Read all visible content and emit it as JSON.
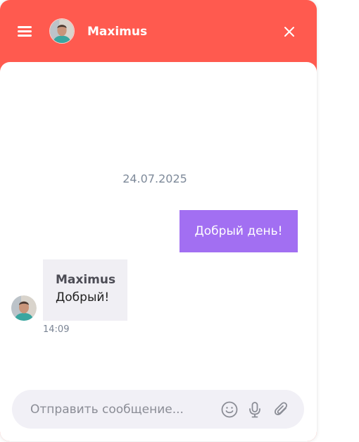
{
  "header": {
    "contact_name": "Maximus",
    "avatar_icon": "user-photo-avatar",
    "menu_icon": "hamburger-menu-icon",
    "close_icon": "close-icon",
    "background_color": "#ff5a4f"
  },
  "conversation": {
    "date_separator": "24.07.2025",
    "messages": [
      {
        "direction": "outgoing",
        "text": "Добрый день!",
        "color": "#a26ff2"
      },
      {
        "direction": "incoming",
        "sender": "Maximus",
        "text": "Добрый!",
        "time": "14:09"
      }
    ]
  },
  "composer": {
    "placeholder": "Отправить сообщение...",
    "value": "",
    "icons": [
      "emoji-icon",
      "microphone-icon",
      "paperclip-icon"
    ]
  }
}
